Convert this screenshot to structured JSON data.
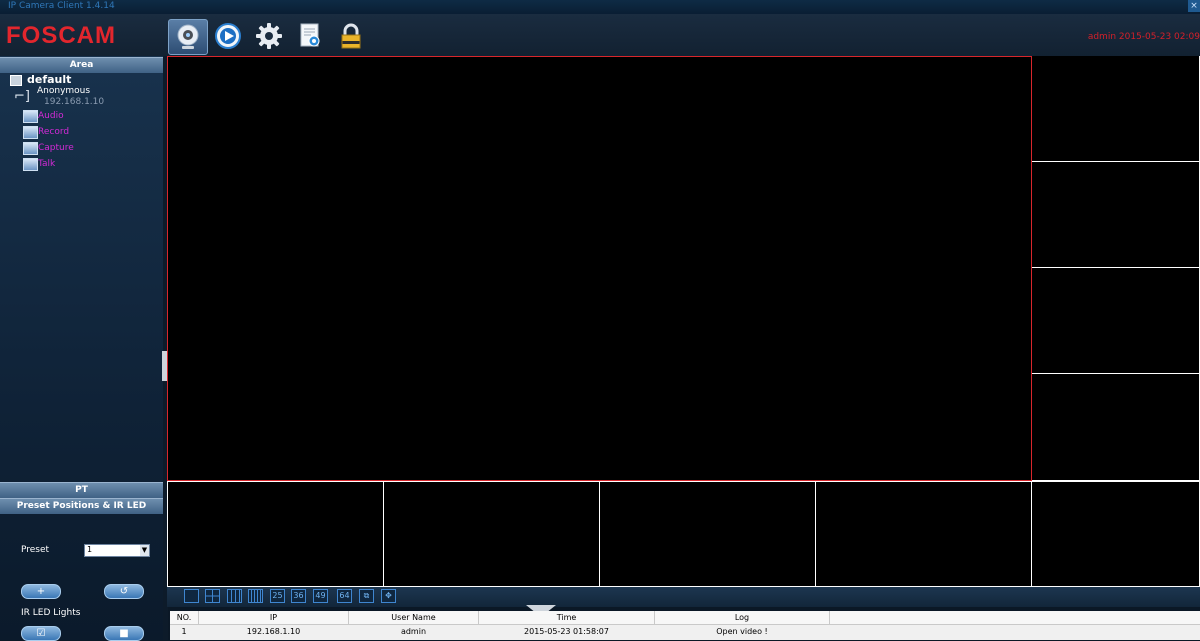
{
  "window": {
    "title": "IP Camera Client 1.4.14",
    "close_glyph": "×"
  },
  "brand": {
    "logo": "FOSCAM",
    "color": "#e3262d"
  },
  "toolbar": {
    "items": [
      {
        "name": "live-video",
        "icon": "webcam-icon",
        "active": true
      },
      {
        "name": "playback",
        "icon": "play-icon",
        "active": false
      },
      {
        "name": "settings",
        "icon": "gear-icon",
        "active": false
      },
      {
        "name": "log-search",
        "icon": "document-search-icon",
        "active": false
      },
      {
        "name": "lock",
        "icon": "lock-icon",
        "active": false
      }
    ]
  },
  "status": {
    "user_datetime": "admin  2015-05-23  02:09"
  },
  "left_panel": {
    "area_header": "Area",
    "tree": {
      "group": "default",
      "camera": {
        "name": "Anonymous",
        "ip": "192.168.1.10"
      },
      "functions": [
        "Audio",
        "Record",
        "Capture",
        "Talk"
      ]
    },
    "pt_header": "PT",
    "preset_header": "Preset Positions & IR LED",
    "preset": {
      "label": "Preset",
      "value": "1"
    },
    "ir_label": "IR LED Lights",
    "add_glyph": "+",
    "go_glyph": "↺",
    "ir_on_glyph": "☑",
    "ir_off_glyph": "■"
  },
  "layout_bar": {
    "buttons": [
      "",
      "",
      "",
      "",
      "25",
      "36",
      "49",
      "64",
      "",
      ""
    ]
  },
  "log_table": {
    "columns": [
      "NO.",
      "IP",
      "User Name",
      "Time",
      "Log"
    ],
    "rows": [
      {
        "no": "1",
        "ip": "192.168.1.10",
        "user": "admin",
        "time": "2015-05-23 01:58:07",
        "log": "Open video !"
      }
    ]
  }
}
